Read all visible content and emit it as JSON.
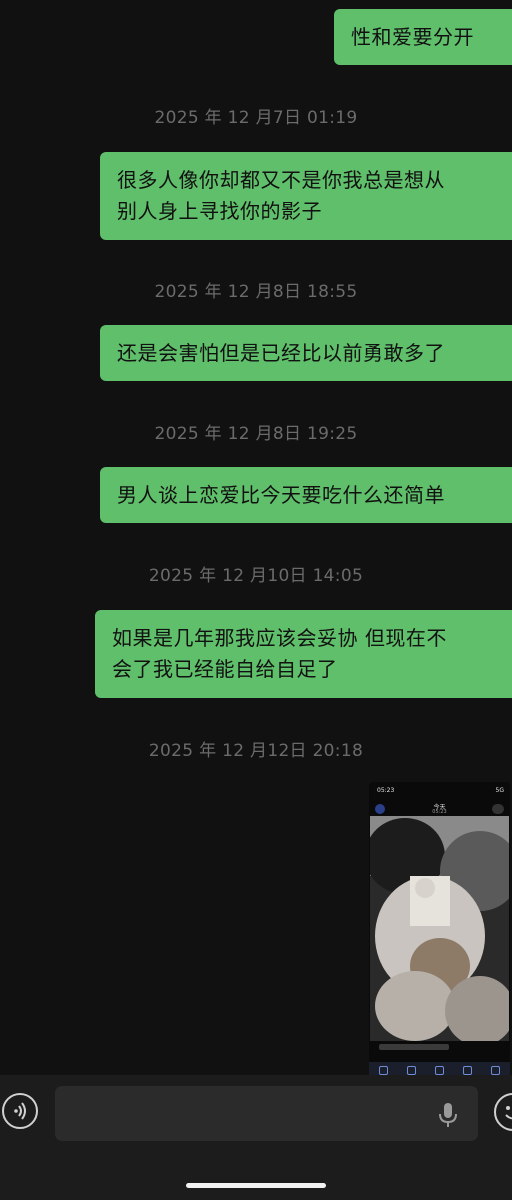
{
  "messages": [
    {
      "kind": "bubble",
      "lines": [
        "性和爱要分开"
      ]
    },
    {
      "kind": "time",
      "text": "2025 年 12 月7日 01:19"
    },
    {
      "kind": "bubble",
      "lines": [
        "很多人像你却都又不是你我总是想从",
        "别人身上寻找你的影子"
      ]
    },
    {
      "kind": "time",
      "text": "2025 年 12 月8日 18:55"
    },
    {
      "kind": "bubble",
      "lines": [
        "还是会害怕但是已经比以前勇敢多了"
      ]
    },
    {
      "kind": "time",
      "text": "2025 年 12 月8日 19:25"
    },
    {
      "kind": "bubble",
      "lines": [
        "男人谈上恋爱比今天要吃什么还简单"
      ]
    },
    {
      "kind": "time",
      "text": "2025 年 12 月10日 14:05"
    },
    {
      "kind": "bubble",
      "lines": [
        "如果是几年那我应该会妥协 但现在不",
        "会了我已经能自给自足了"
      ]
    },
    {
      "kind": "time",
      "text": "2025 年 12 月12日 20:18"
    }
  ],
  "media_message": {
    "status_time": "05:23",
    "status_signal": "5G",
    "header_title": "今天",
    "header_subtitle": "05:23",
    "icon": "screenshot-thumbnail"
  },
  "input_bar": {
    "voice_icon": "voice-icon",
    "mic_icon": "microphone-icon",
    "emoji_icon": "emoji-icon",
    "placeholder": ""
  },
  "colors": {
    "background": "#111111",
    "bubble": "#5fbf6a",
    "timestamp": "#6b6b6b",
    "input_bar": "#1c1c1c"
  }
}
